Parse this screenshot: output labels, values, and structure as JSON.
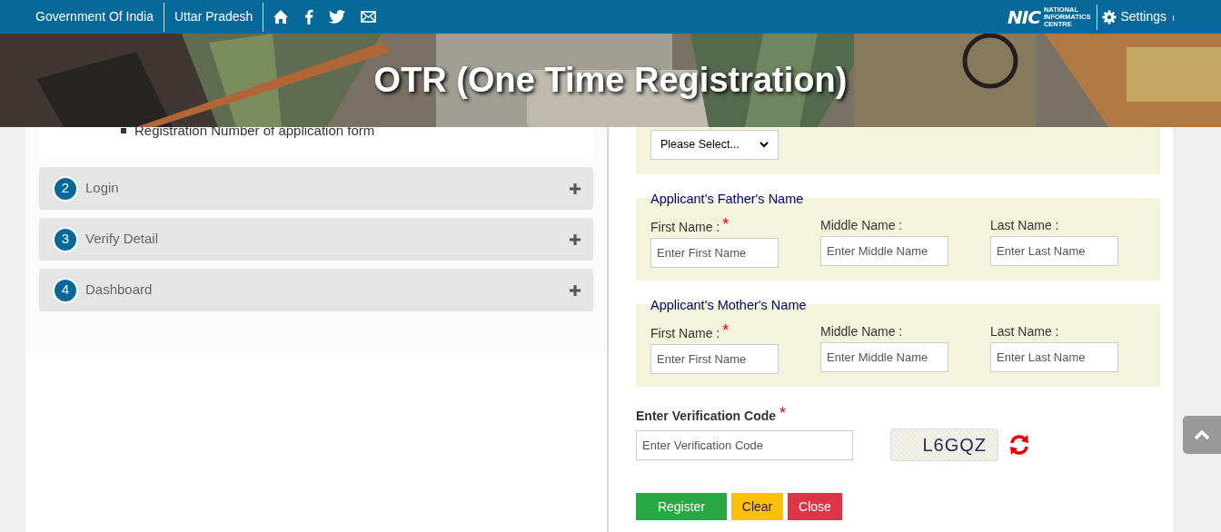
{
  "top_bar": {
    "links": [
      "Government Of India",
      "Uttar Pradesh"
    ],
    "logo": {
      "mark": "NIC",
      "name_lines": [
        "NATIONAL",
        "INFORMATICS",
        "CENTRE"
      ]
    },
    "settings": "Settings"
  },
  "banner": {
    "title": "OTR (One Time Registration)"
  },
  "steps_panel": {
    "list_items": [
      "Registration Number of application form"
    ],
    "steps": [
      {
        "number": "2",
        "label": "Login",
        "expanded": false
      },
      {
        "number": "3",
        "label": "Verify Detail",
        "expanded": false
      },
      {
        "number": "4",
        "label": "Dashboard",
        "expanded": false
      }
    ]
  },
  "form": {
    "select": {
      "value": "Please Select..."
    },
    "sections": [
      {
        "title": "Applicant's Father's Name",
        "fields": [
          {
            "label": "First Name :",
            "required_mark": "*",
            "placeholder": "Enter First Name"
          },
          {
            "label": "Middle Name :",
            "placeholder": "Enter Middle Name"
          },
          {
            "label": "Last Name :",
            "placeholder": "Enter Last Name"
          }
        ]
      },
      {
        "title": "Applicant's Mother's Name",
        "fields": [
          {
            "label": "First Name :",
            "required_mark": "*",
            "placeholder": "Enter First Name"
          },
          {
            "label": "Middle Name :",
            "placeholder": "Enter Middle Name"
          },
          {
            "label": "Last Name :",
            "placeholder": "Enter Last Name"
          }
        ]
      }
    ],
    "verification": {
      "label": "Enter Verification Code",
      "required_mark": "*",
      "placeholder": "Enter Verification Code",
      "captcha": "L6GQZ"
    },
    "buttons": [
      {
        "label": "Register",
        "kind": "success"
      },
      {
        "label": "Clear",
        "kind": "warning"
      },
      {
        "label": "Close",
        "kind": "danger"
      }
    ]
  }
}
